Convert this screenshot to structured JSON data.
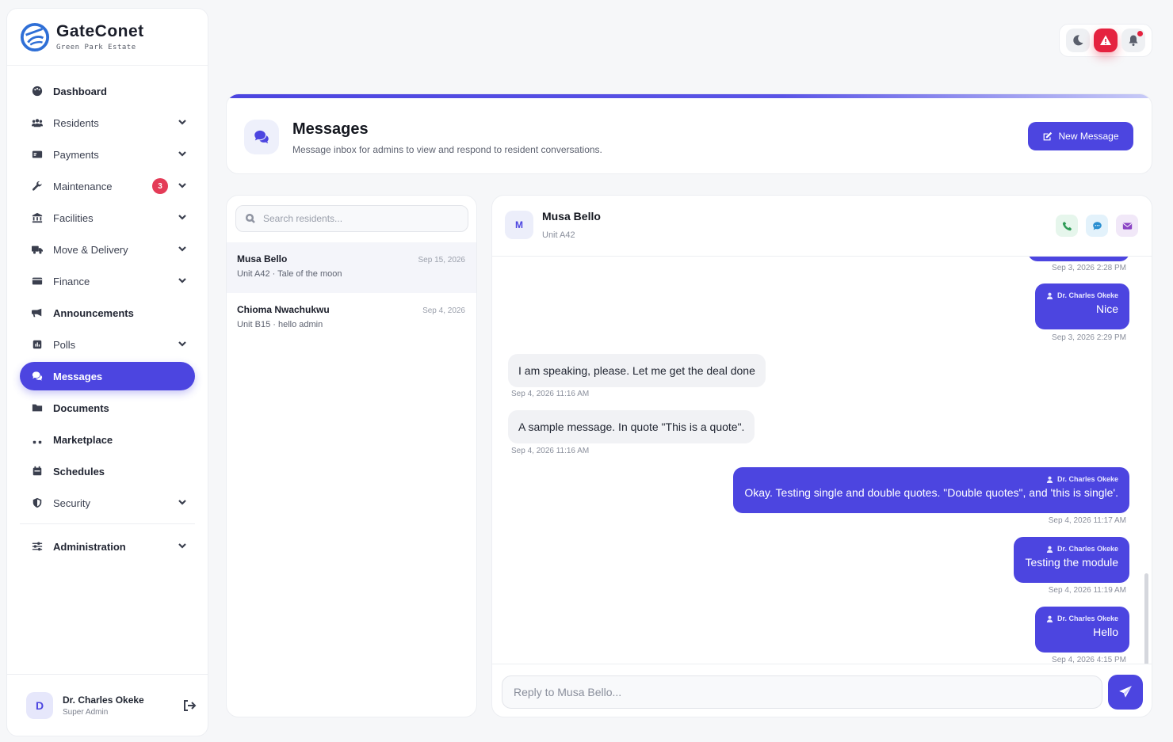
{
  "brand": {
    "name": "GateConet",
    "subtitle": "Green Park Estate",
    "logo_icon": "gateconet-logo"
  },
  "sidebar": {
    "items": [
      {
        "label": "Dashboard",
        "icon": "palette-icon",
        "expandable": false
      },
      {
        "label": "Residents",
        "icon": "users-icon",
        "expandable": true
      },
      {
        "label": "Payments",
        "icon": "money-bill-icon",
        "expandable": true
      },
      {
        "label": "Maintenance",
        "icon": "wrench-icon",
        "expandable": true,
        "badge": "3"
      },
      {
        "label": "Facilities",
        "icon": "landmark-icon",
        "expandable": true
      },
      {
        "label": "Move & Delivery",
        "icon": "truck-icon",
        "expandable": true
      },
      {
        "label": "Finance",
        "icon": "wallet-icon",
        "expandable": true
      },
      {
        "label": "Announcements",
        "icon": "megaphone-icon",
        "expandable": false
      },
      {
        "label": "Polls",
        "icon": "poll-icon",
        "expandable": true
      },
      {
        "label": "Messages",
        "icon": "comments-icon",
        "expandable": false,
        "active": true
      },
      {
        "label": "Documents",
        "icon": "folder-icon",
        "expandable": false
      },
      {
        "label": "Marketplace",
        "icon": "tools-icon",
        "expandable": false
      },
      {
        "label": "Schedules",
        "icon": "calendar-icon",
        "expandable": false
      },
      {
        "label": "Security",
        "icon": "shield-icon",
        "expandable": true
      }
    ],
    "admin": {
      "label": "Administration",
      "icon": "sliders-icon"
    },
    "profile": {
      "initial": "D",
      "name": "Dr. Charles Okeke",
      "role": "Super Admin"
    }
  },
  "toolbar": {
    "buttons": [
      "moon-icon",
      "alert-triangle-icon",
      "bell-icon"
    ]
  },
  "header": {
    "title": "Messages",
    "subtitle": "Message inbox for admins to view and respond to resident conversations.",
    "new_message_label": "New Message"
  },
  "conversations": {
    "search_placeholder": "Search residents...",
    "items": [
      {
        "name": "Musa Bello",
        "date": "Sep 15, 2026",
        "preview": "Unit A42 · Tale of the moon",
        "selected": true
      },
      {
        "name": "Chioma Nwachukwu",
        "date": "Sep 4, 2026",
        "preview": "Unit B15 · hello admin"
      }
    ]
  },
  "chat": {
    "contact": {
      "initial": "M",
      "name": "Musa Bello",
      "unit": "Unit A42"
    },
    "actions": [
      "phone-icon",
      "chat-bubble-icon",
      "envelope-icon"
    ],
    "messages": [
      {
        "dir": "out",
        "sender": "",
        "text": "",
        "time": "Sep 3, 2026 2:28 PM"
      },
      {
        "dir": "out",
        "sender": "Dr. Charles Okeke",
        "text": "Nice",
        "time": "Sep 3, 2026 2:29 PM"
      },
      {
        "dir": "in",
        "text": "I am speaking, please. Let me get the deal done",
        "time": "Sep 4, 2026 11:16 AM"
      },
      {
        "dir": "in",
        "text": "A sample message. In quote \"This is a quote\".",
        "time": "Sep 4, 2026 11:16 AM"
      },
      {
        "dir": "out",
        "sender": "Dr. Charles Okeke",
        "text": "Okay. Testing single and double quotes. \"Double quotes\", and 'this is single'.",
        "time": "Sep 4, 2026 11:17 AM"
      },
      {
        "dir": "out",
        "sender": "Dr. Charles Okeke",
        "text": "Testing the module",
        "time": "Sep 4, 2026 11:19 AM"
      },
      {
        "dir": "out",
        "sender": "Dr. Charles Okeke",
        "text": "Hello",
        "time": "Sep 4, 2026 4:15 PM"
      }
    ],
    "reply_placeholder": "Reply to Musa Bello..."
  },
  "colors": {
    "accent": "#4c45e0",
    "alert": "#e5223f",
    "badge": "#e43b57"
  }
}
